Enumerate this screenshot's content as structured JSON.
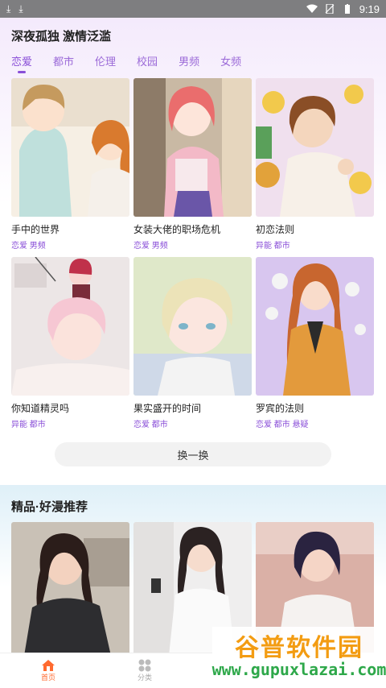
{
  "statusbar": {
    "time": "9:19"
  },
  "header": {
    "headline": "深夜孤独 激情泛滥"
  },
  "tabs": [
    "恋爱",
    "都市",
    "伦理",
    "校园",
    "男频",
    "女频"
  ],
  "comics": [
    {
      "title": "手中的世界",
      "tags": "恋爱 男频"
    },
    {
      "title": "女装大佬的职场危机",
      "tags": "恋爱 男频"
    },
    {
      "title": "初恋法则",
      "tags": "异能 都市"
    },
    {
      "title": "你知道精灵吗",
      "tags": "异能 都市"
    },
    {
      "title": "果实盛开的时间",
      "tags": "恋爱 都市"
    },
    {
      "title": "罗宾的法则",
      "tags": "恋爱 都市 悬疑"
    }
  ],
  "swap_label": "换一换",
  "recommended": {
    "title": "精品·好漫推荐"
  },
  "nav": {
    "home": "首页",
    "category": "分类"
  },
  "watermark": {
    "logo": "谷普软件园",
    "url": "www.gupuxlazai.com"
  }
}
